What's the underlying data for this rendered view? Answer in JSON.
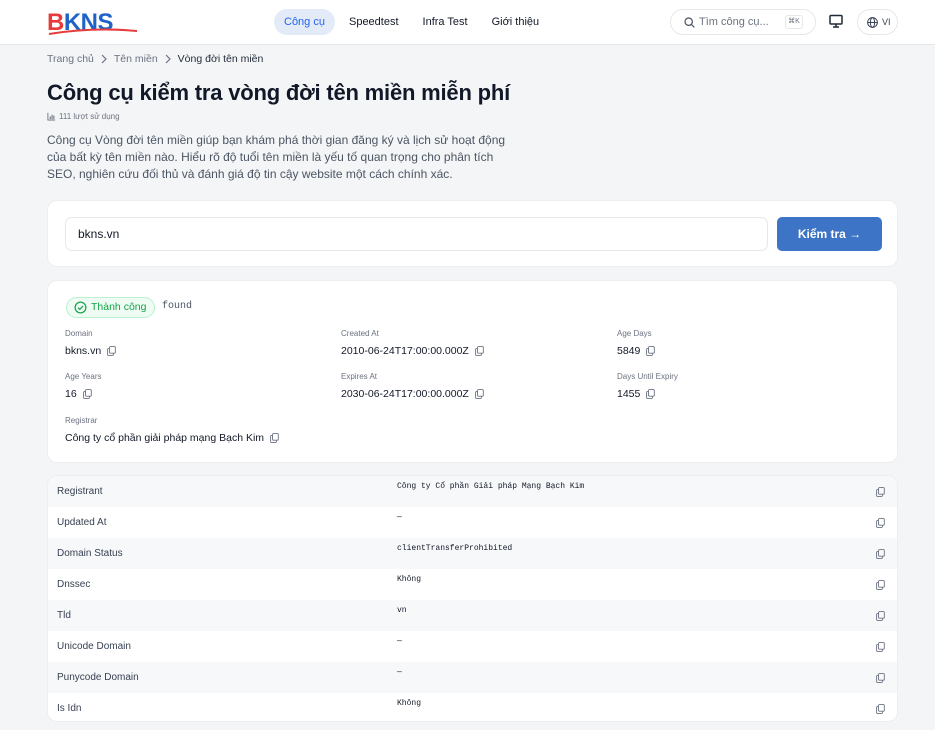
{
  "header": {
    "logo_text": "BKNS",
    "nav": [
      {
        "label": "Công cụ",
        "active": true
      },
      {
        "label": "Speedtest",
        "active": false
      },
      {
        "label": "Infra Test",
        "active": false
      },
      {
        "label": "Giới thiệu",
        "active": false
      }
    ],
    "search": {
      "placeholder": "Tìm công cụ...",
      "shortcut": "⌘K"
    },
    "language": "VI"
  },
  "breadcrumb": [
    "Trang chủ",
    "Tên miền",
    "Vòng đời tên miền"
  ],
  "page": {
    "title": "Công cụ kiểm tra vòng đời tên miền miễn phí",
    "usage": "111 lượt sử dụng",
    "description": "Công cụ Vòng đời tên miền giúp bạn khám phá thời gian đăng ký và lịch sử hoạt động của bất kỳ tên miền nào. Hiểu rõ độ tuổi tên miền là yếu tố quan trọng cho phân tích SEO, nghiên cứu đối thủ và đánh giá độ tin cậy website một cách chính xác."
  },
  "query": {
    "value": "bkns.vn",
    "button": "Kiểm tra →"
  },
  "result": {
    "status": "Thành công",
    "status_code": "found",
    "fields": [
      {
        "label": "Domain",
        "value": "bkns.vn"
      },
      {
        "label": "Created At",
        "value": "2010-06-24T17:00:00.000Z"
      },
      {
        "label": "Age Days",
        "value": "5849"
      },
      {
        "label": "Age Years",
        "value": "16"
      },
      {
        "label": "Expires At",
        "value": "2030-06-24T17:00:00.000Z"
      },
      {
        "label": "Days Until Expiry",
        "value": "1455"
      },
      {
        "label": "Registrar",
        "value": "Công ty cổ phần giải pháp mạng Bạch Kim"
      }
    ]
  },
  "details": [
    {
      "key": "Registrant",
      "value": "Công ty Cổ phần Giải pháp Mạng Bạch Kim"
    },
    {
      "key": "Updated At",
      "value": "—"
    },
    {
      "key": "Domain Status",
      "value": "clientTransferProhibited"
    },
    {
      "key": "Dnssec",
      "value": "Không"
    },
    {
      "key": "Tld",
      "value": "vn"
    },
    {
      "key": "Unicode Domain",
      "value": "—"
    },
    {
      "key": "Punycode Domain",
      "value": "—"
    },
    {
      "key": "Is Idn",
      "value": "Không"
    }
  ],
  "colors": {
    "brand_blue": "#1e64c8",
    "brand_red": "#e63c3c",
    "accent": "#3d74c5",
    "success": "#16a34a"
  }
}
